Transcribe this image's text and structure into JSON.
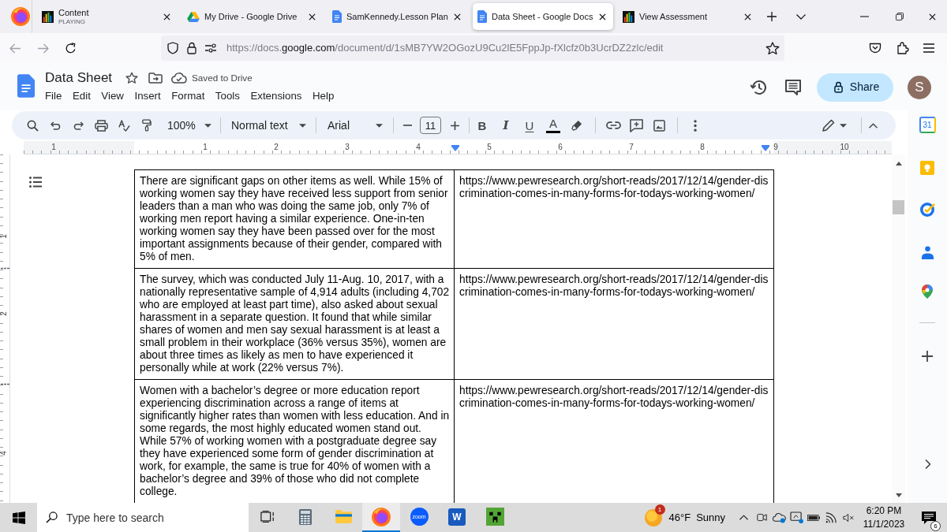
{
  "browser": {
    "tabs": [
      {
        "kind": "media",
        "title": "Content",
        "subtitle": "PLAYING",
        "selected": false
      },
      {
        "kind": "drive",
        "title": "My Drive - Google Drive",
        "selected": false
      },
      {
        "kind": "doc",
        "title": "SamKennedy.Lesson Plan",
        "selected": false
      },
      {
        "kind": "doc",
        "title": "Data Sheet - Google Docs",
        "selected": true
      },
      {
        "kind": "media",
        "title": "View Assessment",
        "selected": false
      }
    ],
    "address": [
      {
        "text": "https://docs.",
        "emphasis": false
      },
      {
        "text": "google.com",
        "emphasis": true
      },
      {
        "text": "/document/d/1sMB7YW2OGozU9Cu2lE5FppJp-fXlcfz0b3UcrDZ2zlc/edit",
        "emphasis": false
      }
    ]
  },
  "document": {
    "title": "Data Sheet",
    "save_status": "Saved to Drive",
    "menu": [
      "File",
      "Edit",
      "View",
      "Insert",
      "Format",
      "Tools",
      "Extensions",
      "Help"
    ],
    "share": "Share",
    "avatar": "S"
  },
  "toolbar": {
    "zoom": "100%",
    "paragraph_style": "Normal text",
    "font": "Arial",
    "font_size": "11",
    "format": [
      {
        "kind": "bold",
        "label": "B"
      },
      {
        "kind": "italic",
        "label": "I"
      },
      {
        "kind": "underline",
        "label": "U"
      },
      {
        "kind": "text-color",
        "label": "A"
      }
    ]
  },
  "ruler": {
    "horizontal": [
      "1",
      "1",
      "2",
      "3",
      "4",
      "5",
      "6",
      "7",
      "8",
      "9",
      "10"
    ],
    "vertical": [
      "1",
      "2",
      "4"
    ]
  },
  "table": {
    "rows": [
      [
        "There are significant gaps on other items as well. While 15% of working women say they have received less support from senior leaders than a man who was doing the same job, only 7% of working men report having a similar experience. One-in-ten working women say they have been passed over for the most important assignments because of their gender, compared with 5% of men.",
        "https://www.pewresearch.org/short-reads/2017/12/14/gender-discrimination-comes-in-many-forms-for-todays-working-women/"
      ],
      [
        "The survey, which was conducted July 11-Aug. 10, 2017, with a nationally representative sample of 4,914 adults (including 4,702 who are employed at least part time), also asked about sexual harassment in a separate question. It found that while similar shares of women and men say sexual harassment is at least a small problem in their workplace (36% versus 35%), women are about three times as likely as men to have experienced it personally while at work (22% versus 7%).",
        "https://www.pewresearch.org/short-reads/2017/12/14/gender-discrimination-comes-in-many-forms-for-todays-working-women/"
      ],
      [
        "Women with a bachelor’s degree or more education report experiencing discrimination across a range of items at significantly higher rates than women with less education. And in some regards, the most highly educated women stand out. While 57% of working women with a postgraduate degree say they have experienced some form of gender discrimination at work, for example, the same is true for 40% of women with a bachelor’s degree and 39% of those who did not complete college.",
        "https://www.pewresearch.org/short-reads/2017/12/14/gender-discrimination-comes-in-many-forms-for-todays-working-women/"
      ]
    ]
  },
  "side_panel": {
    "calendar": "31"
  },
  "taskbar": {
    "search_placeholder": "Type here to search",
    "apps": [
      {
        "kind": "task-view",
        "active": false
      },
      {
        "kind": "calculator",
        "active": false
      },
      {
        "kind": "files",
        "active": false
      },
      {
        "kind": "browser",
        "active": true
      },
      {
        "kind": "video",
        "label": "zoom",
        "active": false
      },
      {
        "kind": "word",
        "label": "W",
        "active": false
      },
      {
        "kind": "game",
        "active": false
      }
    ],
    "weather": {
      "badge": "1",
      "temperature": "46°F",
      "condition": "Sunny"
    },
    "clock": {
      "time": "6:20 PM",
      "date": "11/1/2023"
    },
    "notifications": "6"
  }
}
